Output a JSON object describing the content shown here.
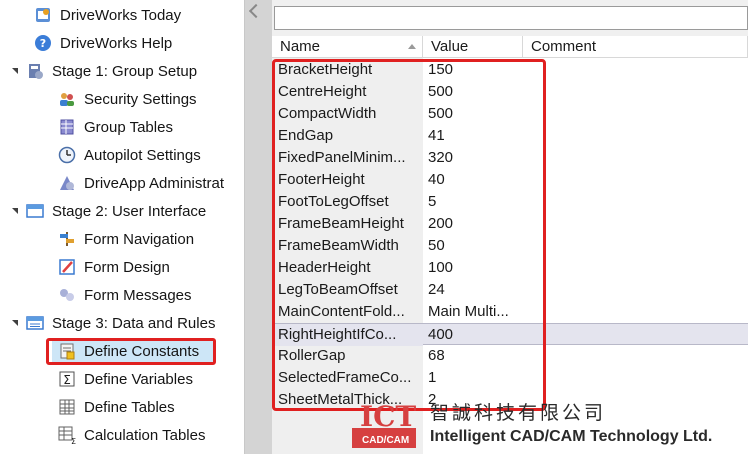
{
  "nav": {
    "items": [
      {
        "label": "DriveWorks Today",
        "icon": "driveworks-today-icon"
      },
      {
        "label": "DriveWorks Help",
        "icon": "help-icon"
      },
      {
        "label": "Stage 1: Group Setup",
        "icon": "group-setup-icon"
      },
      {
        "label": "Security Settings",
        "icon": "users-icon"
      },
      {
        "label": "Group Tables",
        "icon": "group-tables-icon"
      },
      {
        "label": "Autopilot Settings",
        "icon": "clock-icon"
      },
      {
        "label": "DriveApp Administrat",
        "icon": "driveapp-icon"
      },
      {
        "label": "Stage 2: User Interface",
        "icon": "window-icon"
      },
      {
        "label": "Form Navigation",
        "icon": "navigation-icon"
      },
      {
        "label": "Form Design",
        "icon": "form-design-icon"
      },
      {
        "label": "Form Messages",
        "icon": "messages-icon"
      },
      {
        "label": "Stage 3: Data and Rules",
        "icon": "data-rules-icon"
      },
      {
        "label": "Define Constants",
        "icon": "constants-icon",
        "selected": true
      },
      {
        "label": "Define Variables",
        "icon": "sigma-icon"
      },
      {
        "label": "Define Tables",
        "icon": "table-icon"
      },
      {
        "label": "Calculation Tables",
        "icon": "calc-table-icon"
      }
    ]
  },
  "search": {
    "value": ""
  },
  "grid": {
    "headers": {
      "name": "Name",
      "value": "Value",
      "comment": "Comment"
    },
    "rows": [
      {
        "name": "BracketHeight",
        "value": "150"
      },
      {
        "name": "CentreHeight",
        "value": "500"
      },
      {
        "name": "CompactWidth",
        "value": "500"
      },
      {
        "name": "EndGap",
        "value": "41"
      },
      {
        "name": "FixedPanelMinim...",
        "value": "320"
      },
      {
        "name": "FooterHeight",
        "value": "40"
      },
      {
        "name": "FootToLegOffset",
        "value": "5"
      },
      {
        "name": "FrameBeamHeight",
        "value": "200"
      },
      {
        "name": "FrameBeamWidth",
        "value": "50"
      },
      {
        "name": "HeaderHeight",
        "value": "100"
      },
      {
        "name": "LegToBeamOffset",
        "value": "24"
      },
      {
        "name": "MainContentFold...",
        "value": "Main Multi..."
      },
      {
        "name": "RightHeightIfCo...",
        "value": "400",
        "highlight": true
      },
      {
        "name": "RollerGap",
        "value": "68"
      },
      {
        "name": "SelectedFrameCo...",
        "value": "1"
      },
      {
        "name": "SheetMetalThick...",
        "value": "2"
      }
    ]
  },
  "logo": {
    "mark_text": "ICT",
    "mark_sub": "CAD/CAM",
    "chinese": "智誠科技有限公司",
    "english": "Intelligent CAD/CAM Technology Ltd."
  },
  "colors": {
    "highlight_red": "#e02020",
    "selected_bg": "#cde6f7",
    "name_column_bg": "#efefef",
    "row_highlight": "#e4e4ee"
  }
}
